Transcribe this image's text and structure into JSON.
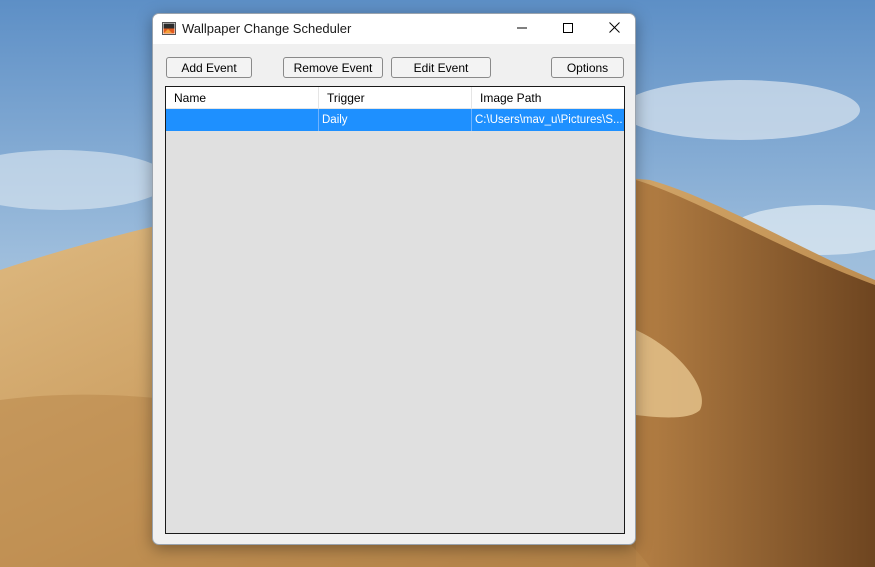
{
  "window": {
    "title": "Wallpaper Change Scheduler"
  },
  "toolbar": {
    "add_label": "Add Event",
    "remove_label": "Remove Event",
    "edit_label": "Edit Event",
    "options_label": "Options"
  },
  "table": {
    "columns": [
      "Name",
      "Trigger",
      "Image Path"
    ],
    "rows": [
      {
        "name": "",
        "trigger": "Daily",
        "image_path": "C:\\Users\\mav_u\\Pictures\\S...",
        "selected": true
      }
    ]
  },
  "icons": {
    "app": "wallpaper-app-icon",
    "minimize": "minimize-icon",
    "maximize": "maximize-icon",
    "close": "close-icon"
  },
  "colors": {
    "selection": "#1e90ff",
    "list_background": "#e0e0e0",
    "window_background": "#f0f0f0"
  }
}
